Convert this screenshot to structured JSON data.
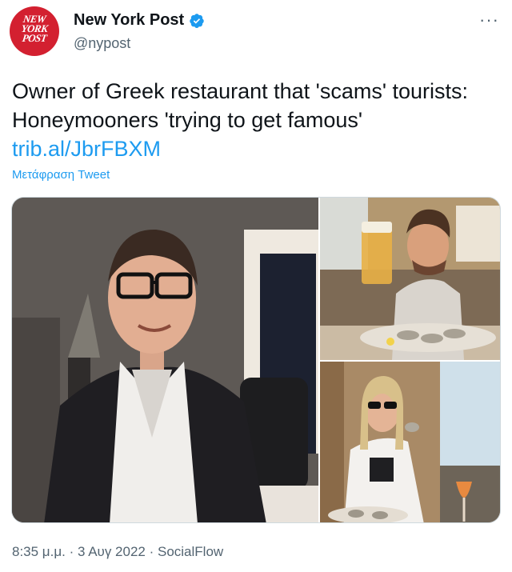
{
  "author": {
    "display_name": "New York Post",
    "handle": "@nypost",
    "verified_icon": "verified-badge-icon",
    "logo_lines": [
      "NEW",
      "YORK",
      "POST"
    ]
  },
  "more_label": "···",
  "tweet": {
    "text": "Owner of Greek restaurant that 'scams' tourists: Honeymooners 'trying to get famous'",
    "link": "trib.al/JbrFBXM",
    "translate_label": "Μετάφραση Tweet"
  },
  "media": {
    "photo_count": 3
  },
  "meta": {
    "timestamp": "8:35 μ.μ. · 3 Αυγ 2022 · SocialFlow"
  },
  "colors": {
    "accent": "#1d9bf0",
    "brand_red": "#d32030",
    "text_primary": "#0f1419",
    "text_secondary": "#536471"
  }
}
